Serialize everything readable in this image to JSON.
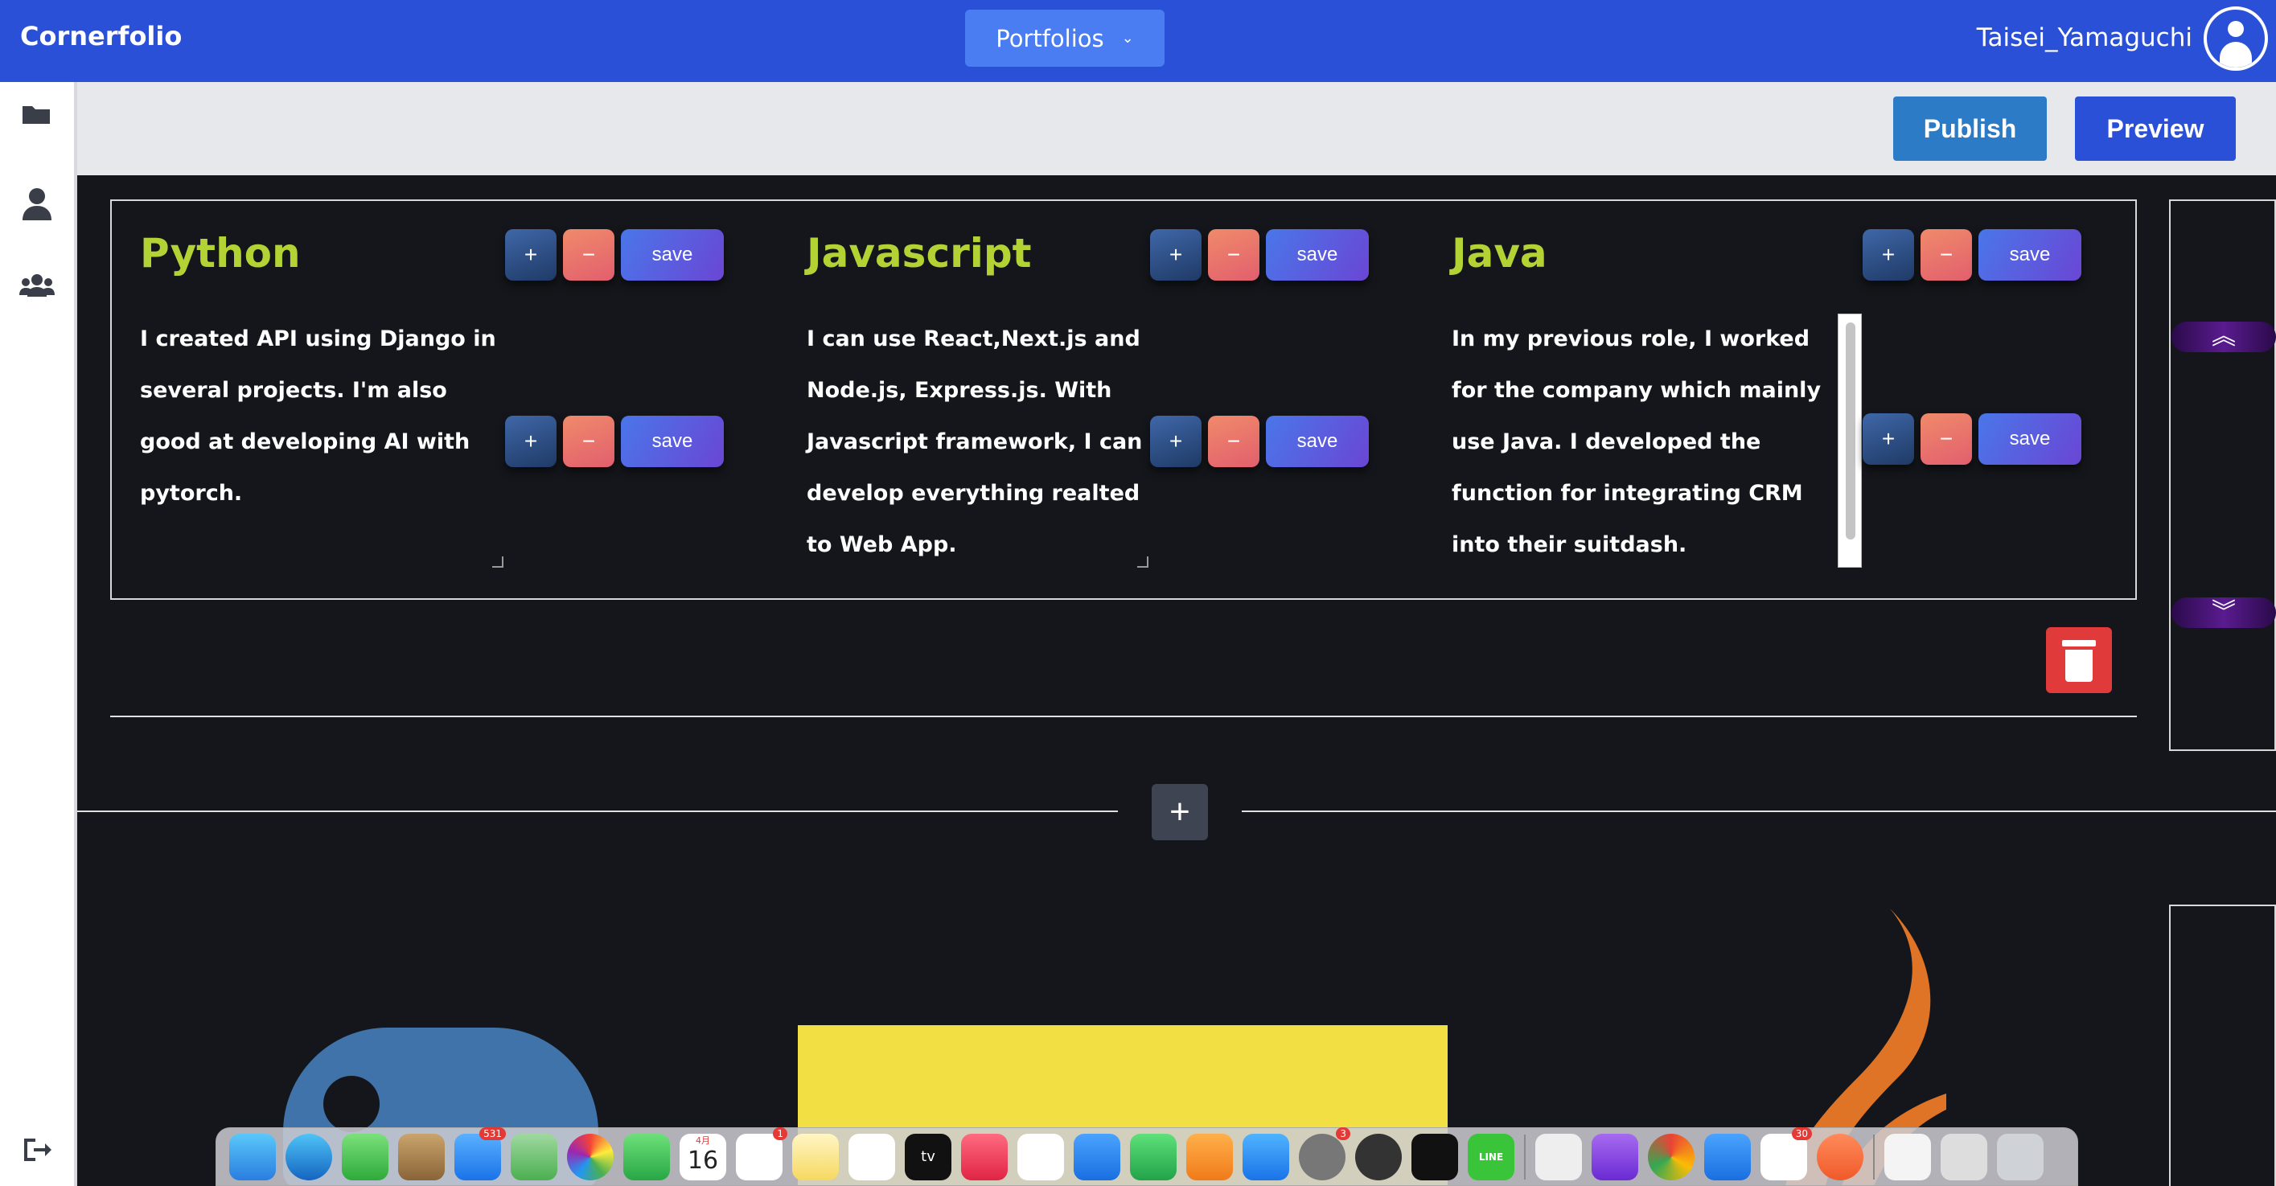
{
  "app": {
    "brand": "Cornerfolio",
    "dropdown_label": "Portfolios",
    "username": "Taisei_Yamaguchi"
  },
  "toolbar": {
    "publish_label": "Publish",
    "preview_label": "Preview"
  },
  "columns": [
    {
      "title": "Python",
      "text": "I created API using Django in several projects. I'm also good at developing AI with pytorch."
    },
    {
      "title": "Javascript",
      "text": "I can use React,Next.js and Node.js, Express.js. With Javascript framework, I can develop everything realted to Web App."
    },
    {
      "title": "Java",
      "text": "In my previous role, I worked for the company which mainly use Java. I developed the function for integrating CRM into their suitdash."
    }
  ],
  "buttons": {
    "plus": "+",
    "minus": "−",
    "save": "save",
    "add_section": "+"
  },
  "dock": {
    "badges": {
      "mail": "531",
      "reminders": "1",
      "settings": "3",
      "slack": "30"
    },
    "calendar_day": "16",
    "calendar_month": "4月",
    "appletv": "tv",
    "line": "LINE"
  },
  "colors": {
    "topbar": "#2a50d8",
    "title_accent": "#b3d335",
    "publish": "#2c7bc6",
    "trash": "#e03a3a"
  }
}
